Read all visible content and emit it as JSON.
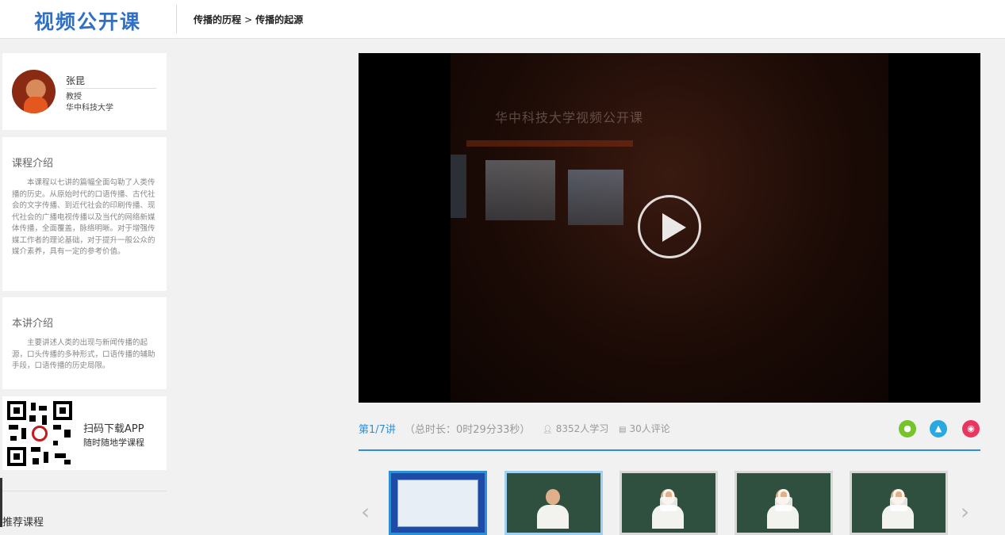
{
  "header": {
    "logo": "视频公开课",
    "breadcrumb": [
      "传播的历程",
      "传播的起源"
    ],
    "breadcrumb_sep": ">"
  },
  "teacher": {
    "name": "张昆",
    "title": "教授",
    "school": "华中科技大学"
  },
  "course_intro": {
    "heading": "课程介绍",
    "text": "本课程以七讲的篇幅全面勾勒了人类传播的历史。从原始时代的口语传播、古代社会的文字传播、到近代社会的印刷传播、现代社会的广播电视传播以及当代的网络新媒体传播，全面覆盖，脉络明晰。对于增强传媒工作者的理论基础，对于提升一般公众的媒介素养，具有一定的参考价值。"
  },
  "lecture_intro": {
    "heading": "本讲介绍",
    "text": "主要讲述人类的出现与新闻传播的起源，口头传播的多种形式，口语传播的辅助手段，口语传播的历史局限。"
  },
  "app_promo": {
    "title": "扫码下载APP",
    "subtitle": "随时随地学课程"
  },
  "recommend": {
    "heading": "推荐课程"
  },
  "video": {
    "stage_text": "华中科技大学视频公开课"
  },
  "lecture_meta": {
    "lecture_num": "第1/7讲",
    "duration": "（总时长：0时29分33秒）",
    "learners": "8352人学习",
    "comments": "30人评论"
  },
  "share": {
    "wechat_icon": "wechat-icon",
    "qq_icon": "qq-icon",
    "weibo_icon": "weibo-icon"
  },
  "thumbnails": [
    {
      "state": "active",
      "locked": false,
      "kind": "slide"
    },
    {
      "state": "hover",
      "locked": false,
      "kind": "speaker"
    },
    {
      "state": "normal",
      "locked": true,
      "kind": "speaker"
    },
    {
      "state": "normal",
      "locked": true,
      "kind": "speaker"
    },
    {
      "state": "normal",
      "locked": true,
      "kind": "speaker"
    }
  ],
  "colors": {
    "accent": "#2f8fd5",
    "logo": "#2f6fc4",
    "wechat": "#76c42a",
    "qq": "#2aa9e0",
    "weibo": "#e8365f"
  }
}
